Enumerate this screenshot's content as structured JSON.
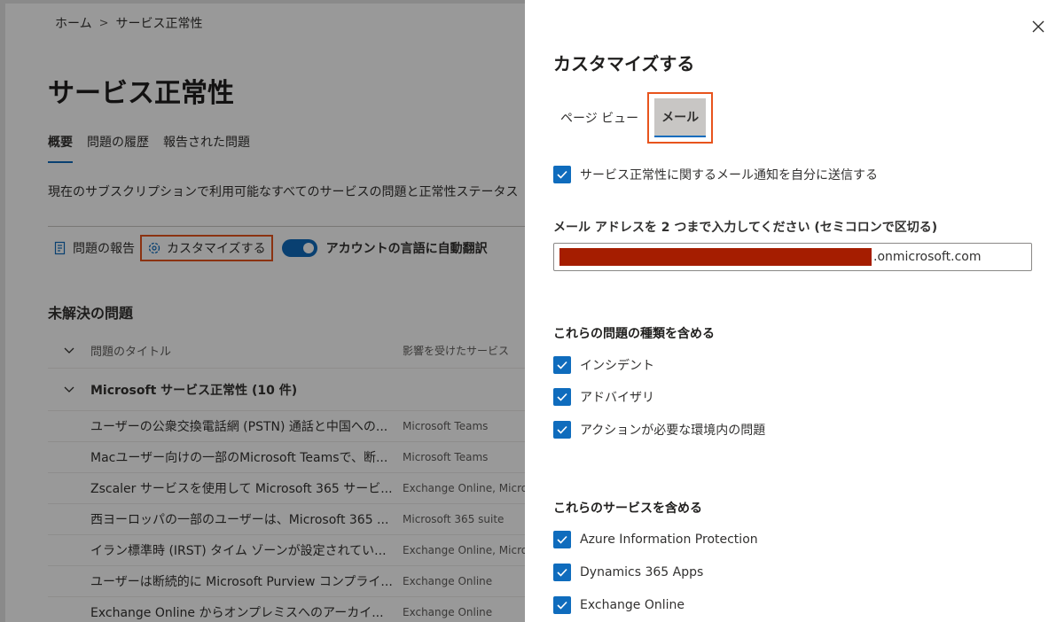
{
  "breadcrumb": {
    "home": "ホーム",
    "current": "サービス正常性"
  },
  "page": {
    "title": "サービス正常性",
    "tabs": [
      "概要",
      "問題の履歴",
      "報告された問題"
    ],
    "description": "現在のサブスクリプションで利用可能なすべてのサービスの問題と正常性ステータス",
    "commands": {
      "report": "問題の報告",
      "customize": "カスタマイズする",
      "auto_translate": "アカウントの言語に自動翻訳"
    },
    "auto_translate_on": true,
    "open_issues_title": "未解決の問題",
    "table": {
      "col_title": "問題のタイトル",
      "col_service": "影響を受けたサービス",
      "group": "Microsoft サービス正常性 (10 件)",
      "rows": [
        {
          "title": "ユーザーの公衆交換電話網 (PSTN) 通話と中国への...",
          "service": "Microsoft Teams"
        },
        {
          "title": "Macユーザー向けの一部のMicrosoft Teamsで、断...",
          "service": "Microsoft Teams"
        },
        {
          "title": "Zscaler サービスを使用して Microsoft 365 サービ...",
          "service": "Exchange Online, Microso"
        },
        {
          "title": "西ヨーロッパの一部のユーザーは、Microsoft 365 ...",
          "service": "Microsoft 365 suite"
        },
        {
          "title": "イラン標準時 (IRST) タイム ゾーンが設定されてい...",
          "service": "Exchange Online, Microso"
        },
        {
          "title": "ユーザーは断続的に Microsoft Purview コンプライ...",
          "service": "Exchange Online"
        },
        {
          "title": "Exchange Online からオンプレミスへのアーカイ...",
          "service": "Exchange Online"
        }
      ]
    }
  },
  "panel": {
    "title": "カスタマイズする",
    "tabs": {
      "page_view": "ページ ビュー",
      "mail": "メール"
    },
    "send_mail_label": "サービス正常性に関するメール通知を自分に送信する",
    "email_field_label": "メール アドレスを 2 つまで入力してください (セミコロンで区切る)",
    "email_suffix": ".onmicrosoft.com",
    "issue_types_heading": "これらの問題の種類を含める",
    "issue_types": [
      "インシデント",
      "アドバイザリ",
      "アクションが必要な環境内の問題"
    ],
    "services_heading": "これらのサービスを含める",
    "services": [
      "Azure Information Protection",
      "Dynamics 365 Apps",
      "Exchange Online"
    ]
  },
  "colors": {
    "accent": "#0f6cbd",
    "highlight": "#e8541d",
    "redaction": "#a51d00"
  }
}
